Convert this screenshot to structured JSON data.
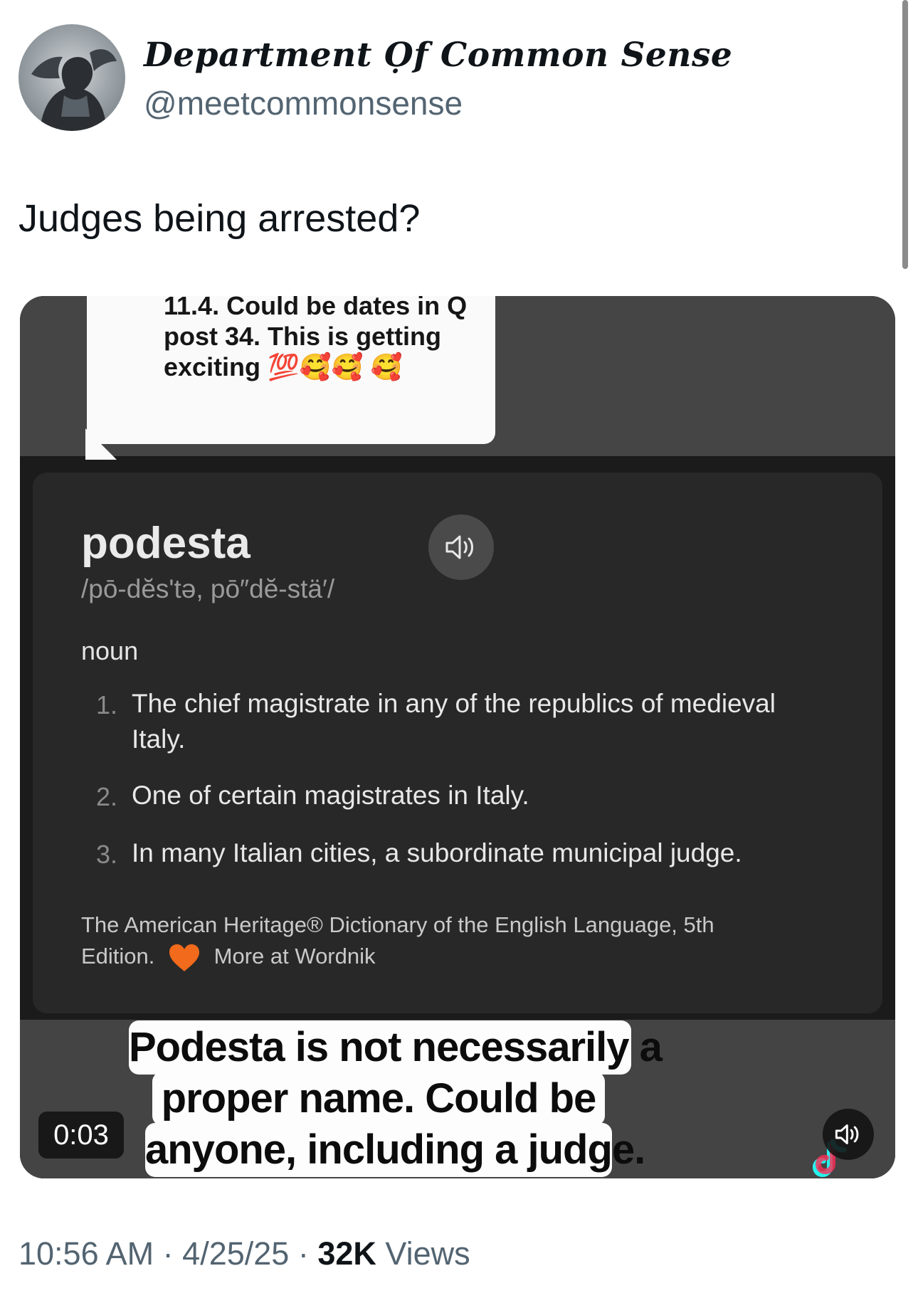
{
  "author": {
    "display_name": "Department Ọf Common Sense",
    "handle": "@meetcommonsense",
    "avatar_icon": "profile-avatar"
  },
  "tweet": {
    "text": "Judges being arrested?"
  },
  "video": {
    "comment_text": "11.4. Could be dates in Q post 34. This is getting exciting 💯🥰🥰 🥰",
    "dictionary": {
      "word": "podesta",
      "pronunciation": "/pō-dĕsʹtə, pō″dĕ-stä′/",
      "part_of_speech": "noun",
      "definitions": [
        {
          "num": "1.",
          "text": "The chief magistrate in any of the republics of medieval Italy."
        },
        {
          "num": "2.",
          "text": "One of certain magistrates in Italy."
        },
        {
          "num": "3.",
          "text": "In many Italian cities, a subordinate municipal judge."
        }
      ],
      "source": "The American Heritage® Dictionary of the English Language, 5th Edition.",
      "more_link": "More at Wordnik",
      "speaker_icon": "speaker-icon"
    },
    "caption_lines": [
      "Podesta is not necessarily a",
      "proper name. Could be",
      "anyone, including a judge."
    ],
    "timestamp": "0:03",
    "mute_icon": "speaker-icon",
    "watermark_icon": "tiktok-logo"
  },
  "meta": {
    "time": "10:56 AM",
    "separator": "·",
    "date": "4/25/25",
    "views_count": "32K",
    "views_label": "Views"
  },
  "colors": {
    "text_primary": "#0f1419",
    "text_secondary": "#536471",
    "heart_orange": "#f26a1b"
  }
}
